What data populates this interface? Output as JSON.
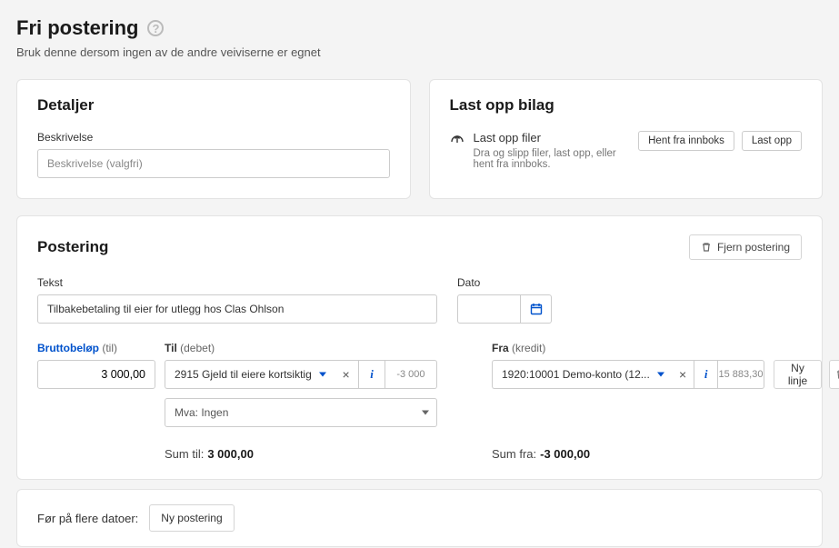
{
  "header": {
    "title": "Fri postering",
    "subtitle": "Bruk denne dersom ingen av de andre veiviserne er egnet"
  },
  "detaljer": {
    "title": "Detaljer",
    "desc_label": "Beskrivelse",
    "desc_placeholder": "Beskrivelse (valgfri)"
  },
  "upload": {
    "title": "Last opp bilag",
    "action_title": "Last opp filer",
    "action_sub": "Dra og slipp filer, last opp, eller hent fra innboks.",
    "btn_inbox": "Hent fra innboks",
    "btn_upload": "Last opp"
  },
  "postering": {
    "title": "Postering",
    "remove_btn": "Fjern postering",
    "tekst_label": "Tekst",
    "tekst_value": "Tilbakebetaling til eier for utlegg hos Clas Ohlson",
    "dato_label": "Dato",
    "dato_value": "",
    "col_brutto": "Bruttobeløp",
    "col_brutto_sub": "(til)",
    "col_til": "Til",
    "col_til_sub": "(debet)",
    "col_fra": "Fra",
    "col_fra_sub": "(kredit)",
    "line": {
      "amount": "3 000,00",
      "til_account": "2915 Gjeld til eiere kortsiktig",
      "til_balance": "-3 000",
      "fra_account": "1920:10001 Demo-konto (12...",
      "fra_balance": "15 883,30",
      "mva": "Mva: Ingen",
      "ny_linje": "Ny linje"
    },
    "sum_til_label": "Sum til:",
    "sum_til_value": "3 000,00",
    "sum_fra_label": "Sum fra:",
    "sum_fra_value": "-3 000,00"
  },
  "footer": {
    "label": "Før på flere datoer:",
    "btn": "Ny postering"
  }
}
